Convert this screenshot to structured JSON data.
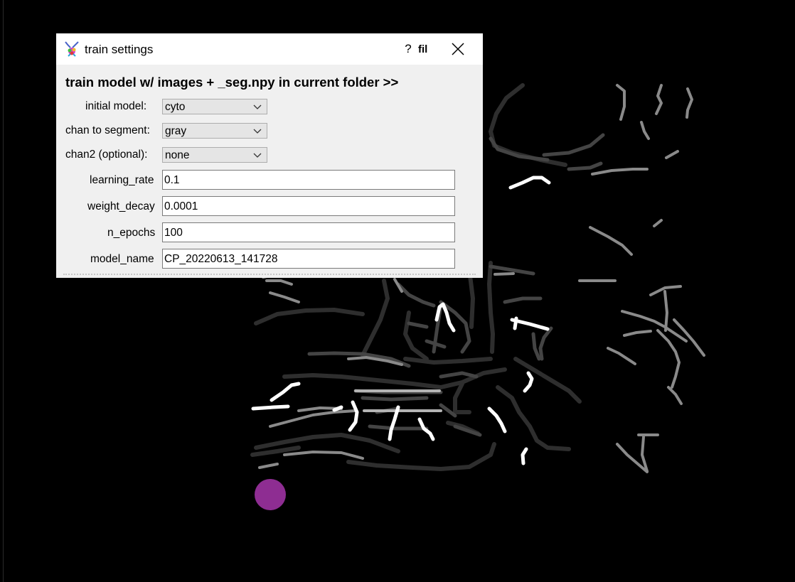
{
  "dialog": {
    "title": "train settings",
    "help_label": "?",
    "heading": "train model w/ images + _seg.npy in current folder >>",
    "overflow_text": "fil",
    "fields": {
      "initial_model": {
        "label": "initial model:",
        "value": "cyto"
      },
      "chan_to_segment": {
        "label": "chan to segment:",
        "value": "gray"
      },
      "chan2": {
        "label": "chan2 (optional):",
        "value": "none"
      },
      "learning_rate": {
        "label": "learning_rate",
        "value": "0.1"
      },
      "weight_decay": {
        "label": "weight_decay",
        "value": "0.0001"
      },
      "n_epochs": {
        "label": "n_epochs",
        "value": "100"
      },
      "model_name": {
        "label": "model_name",
        "value": "CP_20220613_141728"
      }
    }
  },
  "colors": {
    "background": "#000000",
    "dialog_bg": "#f0f0f0",
    "titlebar_bg": "#ffffff",
    "marker": "#8e2d92"
  },
  "icons": {
    "app": "cellpose-logo-icon",
    "close": "close-icon",
    "dropdown": "chevron-down-icon"
  }
}
